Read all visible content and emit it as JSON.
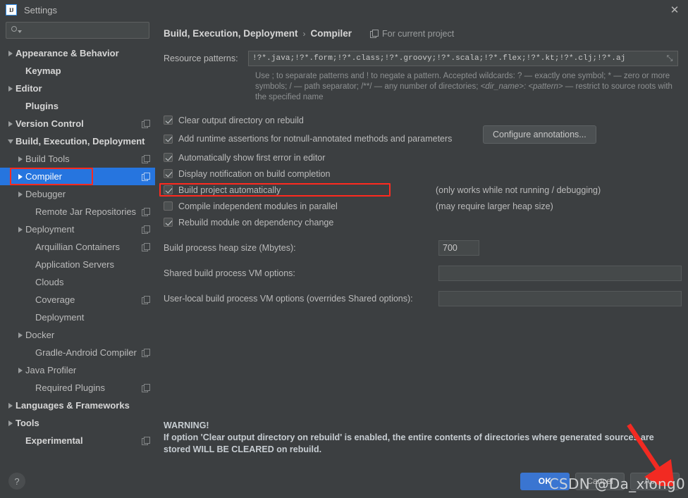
{
  "window": {
    "title": "Settings",
    "logo_text": "IJ",
    "close_label": "✕"
  },
  "sidebar": {
    "search": {
      "placeholder": "",
      "value": "",
      "icon": "search-icon"
    },
    "items": [
      {
        "label": "Appearance & Behavior",
        "indent": 0,
        "arrow": "closed",
        "bold": true,
        "copy": false,
        "selected": false
      },
      {
        "label": "Keymap",
        "indent": 1,
        "arrow": "none",
        "bold": true,
        "copy": false,
        "selected": false
      },
      {
        "label": "Editor",
        "indent": 0,
        "arrow": "closed",
        "bold": true,
        "copy": false,
        "selected": false
      },
      {
        "label": "Plugins",
        "indent": 1,
        "arrow": "none",
        "bold": true,
        "copy": false,
        "selected": false
      },
      {
        "label": "Version Control",
        "indent": 0,
        "arrow": "closed",
        "bold": true,
        "copy": true,
        "selected": false
      },
      {
        "label": "Build, Execution, Deployment",
        "indent": 0,
        "arrow": "open",
        "bold": true,
        "copy": false,
        "selected": false
      },
      {
        "label": "Build Tools",
        "indent": 1,
        "arrow": "closed",
        "bold": false,
        "copy": true,
        "selected": false
      },
      {
        "label": "Compiler",
        "indent": 1,
        "arrow": "closed",
        "bold": false,
        "copy": true,
        "selected": true
      },
      {
        "label": "Debugger",
        "indent": 1,
        "arrow": "closed",
        "bold": false,
        "copy": false,
        "selected": false
      },
      {
        "label": "Remote Jar Repositories",
        "indent": 2,
        "arrow": "none",
        "bold": false,
        "copy": true,
        "selected": false
      },
      {
        "label": "Deployment",
        "indent": 1,
        "arrow": "closed",
        "bold": false,
        "copy": true,
        "selected": false
      },
      {
        "label": "Arquillian Containers",
        "indent": 2,
        "arrow": "none",
        "bold": false,
        "copy": true,
        "selected": false
      },
      {
        "label": "Application Servers",
        "indent": 2,
        "arrow": "none",
        "bold": false,
        "copy": false,
        "selected": false
      },
      {
        "label": "Clouds",
        "indent": 2,
        "arrow": "none",
        "bold": false,
        "copy": false,
        "selected": false
      },
      {
        "label": "Coverage",
        "indent": 2,
        "arrow": "none",
        "bold": false,
        "copy": true,
        "selected": false
      },
      {
        "label": "Deployment",
        "indent": 2,
        "arrow": "none",
        "bold": false,
        "copy": false,
        "selected": false
      },
      {
        "label": "Docker",
        "indent": 1,
        "arrow": "closed",
        "bold": false,
        "copy": false,
        "selected": false
      },
      {
        "label": "Gradle-Android Compiler",
        "indent": 2,
        "arrow": "none",
        "bold": false,
        "copy": true,
        "selected": false
      },
      {
        "label": "Java Profiler",
        "indent": 1,
        "arrow": "closed",
        "bold": false,
        "copy": false,
        "selected": false
      },
      {
        "label": "Required Plugins",
        "indent": 2,
        "arrow": "none",
        "bold": false,
        "copy": true,
        "selected": false
      },
      {
        "label": "Languages & Frameworks",
        "indent": 0,
        "arrow": "closed",
        "bold": true,
        "copy": false,
        "selected": false
      },
      {
        "label": "Tools",
        "indent": 0,
        "arrow": "closed",
        "bold": true,
        "copy": false,
        "selected": false
      },
      {
        "label": "Experimental",
        "indent": 1,
        "arrow": "none",
        "bold": true,
        "copy": true,
        "selected": false
      }
    ]
  },
  "main": {
    "breadcrumb_root": "Build, Execution, Deployment",
    "breadcrumb_sep": "›",
    "breadcrumb_leaf": "Compiler",
    "scope_label": "For current project",
    "resource_patterns": {
      "label": "Resource patterns:",
      "value": "!?*.java;!?*.form;!?*.class;!?*.groovy;!?*.scala;!?*.flex;!?*.kt;!?*.clj;!?*.aj",
      "expand_icon": "⤡"
    },
    "help_text_line1": "Use ; to separate patterns and ! to negate a pattern. Accepted wildcards: ? — exactly one symbol; * — zero or more",
    "help_text_line2_a": "symbols; / — path separator; /**/ — any number of directories;  ",
    "help_text_line2_i": "<dir_name>: <pattern>",
    "help_text_line2_b": " — restrict to source roots",
    "help_text_line3": "with the specified name",
    "checkboxes": [
      {
        "label": "Clear output directory on rebuild",
        "checked": true,
        "note": ""
      },
      {
        "label": "Add runtime assertions for notnull-annotated methods and parameters",
        "checked": true,
        "note": ""
      },
      {
        "label": "Automatically show first error in editor",
        "checked": true,
        "note": ""
      },
      {
        "label": "Display notification on build completion",
        "checked": true,
        "note": ""
      },
      {
        "label": "Build project automatically",
        "checked": true,
        "note": "(only works while not running / debugging)"
      },
      {
        "label": "Compile independent modules in parallel",
        "checked": false,
        "note": "(may require larger heap size)"
      },
      {
        "label": "Rebuild module on dependency change",
        "checked": true,
        "note": ""
      }
    ],
    "configure_annotations_label": "Configure annotations...",
    "fields": [
      {
        "label": "Build process heap size (Mbytes):",
        "value": "700",
        "kind": "heap"
      },
      {
        "label": "Shared build process VM options:",
        "value": "",
        "kind": "shared"
      },
      {
        "label": "User-local build process VM options (overrides Shared options):",
        "value": "",
        "kind": "userlocal"
      }
    ],
    "warning": {
      "title": "WARNING!",
      "line1": "If option 'Clear output directory on rebuild' is enabled, the entire contents of directories where generated sources are",
      "line2": "stored WILL BE CLEARED on rebuild."
    }
  },
  "footer": {
    "help_label": "?",
    "ok_label": "OK",
    "cancel_label": "Cancel",
    "apply_label": "Apply"
  },
  "overlay": {
    "watermark": "CSDN @Da_xiong0",
    "highlight_color": "#ff2a1f",
    "arrow_color": "#f22a22"
  },
  "colors": {
    "background": "#3c3f41",
    "selection": "#2675df",
    "accent": "#3a75d1",
    "text": "#bbbbbb"
  }
}
